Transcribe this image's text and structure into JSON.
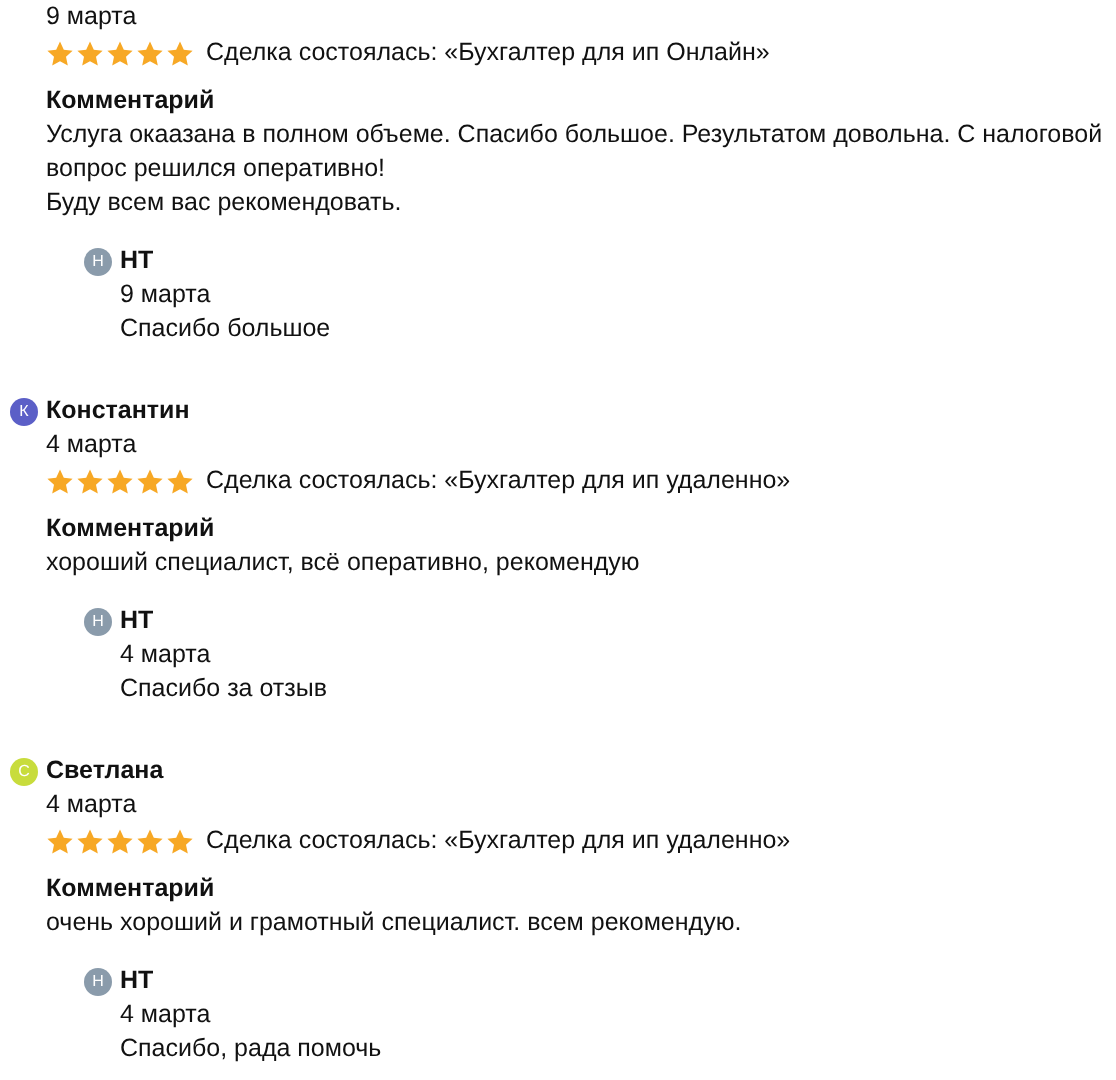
{
  "reviews": [
    {
      "date": "9 марта",
      "stars": 5,
      "deal": "Сделка состоялась: «Бухгалтер для ип Онлайн»",
      "comment_label": "Комментарий",
      "comment": [
        "Услуга окаазана в полном объеме. Спасибо большое. Результатом довольна. С налоговой вопрос решился оперативно!",
        "Буду всем вас рекомендовать."
      ],
      "reply": {
        "avatar_letter": "Н",
        "color": "#8a9bab",
        "name": "НТ",
        "date": "9 марта",
        "text": "Спасибо большое"
      }
    },
    {
      "author": "Константин",
      "avatar_letter": "К",
      "color": "#5b5fc7",
      "date": "4 марта",
      "stars": 5,
      "deal": "Сделка состоялась: «Бухгалтер для ип удаленно»",
      "comment_label": "Комментарий",
      "comment": [
        "хороший специалист, всё оперативно, рекомендую"
      ],
      "reply": {
        "avatar_letter": "Н",
        "color": "#8a9bab",
        "name": "НТ",
        "date": "4 марта",
        "text": "Спасибо за отзыв"
      }
    },
    {
      "author": "Светлана",
      "avatar_letter": "С",
      "color": "#c8dc3c",
      "date": "4 марта",
      "stars": 5,
      "deal": "Сделка состоялась: «Бухгалтер для ип удаленно»",
      "comment_label": "Комментарий",
      "comment": [
        "очень хороший и грамотный специалист. всем рекомендую."
      ],
      "reply": {
        "avatar_letter": "Н",
        "color": "#8a9bab",
        "name": "НТ",
        "date": "4 марта",
        "text": "Спасибо, рада помочь"
      }
    }
  ]
}
